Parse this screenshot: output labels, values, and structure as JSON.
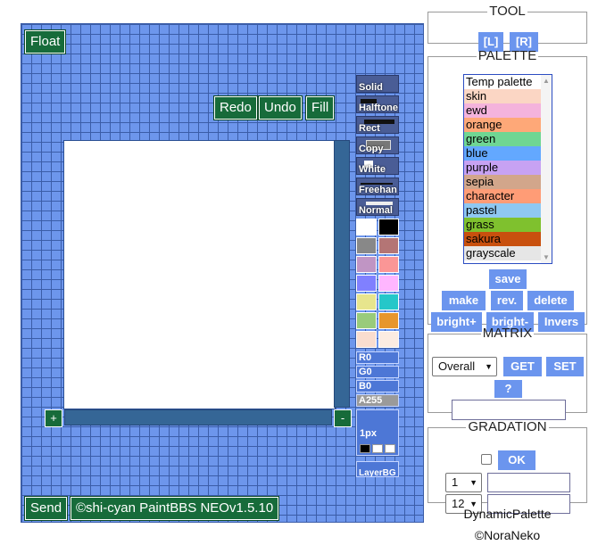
{
  "neo": {
    "float_label": "Float",
    "redo_label": "Redo",
    "undo_label": "Undo",
    "fill_label": "Fill",
    "zoom_in_label": "+",
    "zoom_out_label": "-",
    "send_label": "Send",
    "copyright_label": "©shi-cyan PaintBBS NEOv1.5.10",
    "tools": [
      "Solid",
      "Halftone",
      "Rect",
      "Copy",
      "White",
      "Freehan",
      "Normal"
    ],
    "swatches": [
      "#ffffff",
      "#000000",
      "#888888",
      "#b47575",
      "#c095c4",
      "#fa9696",
      "#8080ff",
      "#ffb6ff",
      "#e7e58d",
      "#25c7c9",
      "#99cb7b",
      "#e7962d",
      "#f9ddcf",
      "#fcece2"
    ],
    "rgba": [
      "R0",
      "G0",
      "B0",
      "A255"
    ],
    "brush_size": "1px",
    "layer_bg": "LayerBG"
  },
  "tool_panel": {
    "title": "TOOL",
    "left_label": "[L]",
    "right_label": "[R]"
  },
  "palette": {
    "title": "PALETTE",
    "items": [
      {
        "label": "Temp palette",
        "color": "#ffffff"
      },
      {
        "label": "skin",
        "color": "#fbd6c4"
      },
      {
        "label": "ewd",
        "color": "#f4b3dc"
      },
      {
        "label": "orange",
        "color": "#fea878"
      },
      {
        "label": "green",
        "color": "#6fd693"
      },
      {
        "label": "blue",
        "color": "#63a8ff"
      },
      {
        "label": "purple",
        "color": "#c7a2f3"
      },
      {
        "label": "sepia",
        "color": "#d2a68b"
      },
      {
        "label": "character",
        "color": "#ff9c76"
      },
      {
        "label": "pastel",
        "color": "#8fc8f2"
      },
      {
        "label": "grass",
        "color": "#7fc12e"
      },
      {
        "label": "sakura",
        "color": "#c8500e"
      },
      {
        "label": "grayscale",
        "color": "#e6e6e6"
      }
    ],
    "save_label": "save",
    "make_label": "make",
    "rev_label": "rev.",
    "delete_label": "delete",
    "bright_plus_label": "bright+",
    "bright_minus_label": "bright-",
    "invers_label": "Invers"
  },
  "matrix": {
    "title": "MATRIX",
    "selected": "Overall",
    "get_label": "GET",
    "set_label": "SET",
    "help_label": "?"
  },
  "gradation": {
    "title": "GRADATION",
    "ok_label": "OK",
    "start_value": "1",
    "end_value": "12"
  },
  "credits": {
    "line1": "DynamicPalette",
    "line2": "©NoraNeko"
  }
}
